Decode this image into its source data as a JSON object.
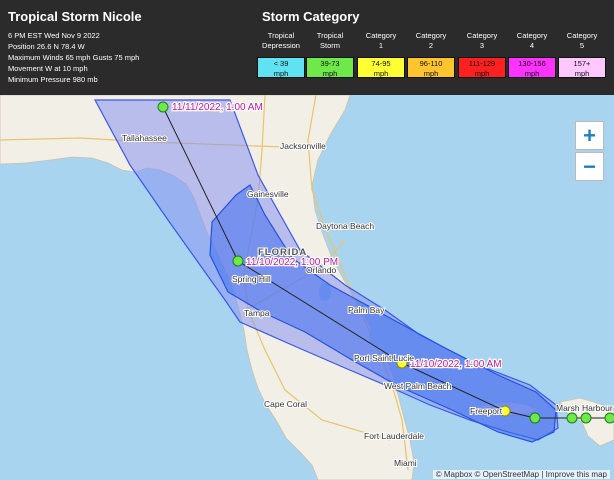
{
  "storm": {
    "name": "Tropical Storm Nicole",
    "info": [
      "6 PM EST Wed Nov 9 2022",
      "Position 26.6 N 78.4 W",
      "Maximum Winds 65 mph Gusts 75 mph",
      "Movement W at 10 mph",
      "Minimum Pressure 980 mb"
    ]
  },
  "category": {
    "title": "Storm Category",
    "items": [
      {
        "line1": "Tropical",
        "line2": "Depression",
        "range": "< 39",
        "unit": "mph",
        "color": "#5fe3f2"
      },
      {
        "line1": "Tropical",
        "line2": "Storm",
        "range": "39-73",
        "unit": "mph",
        "color": "#6fe84a"
      },
      {
        "line1": "Category",
        "line2": "1",
        "range": "74-95",
        "unit": "mph",
        "color": "#ffff33"
      },
      {
        "line1": "Category",
        "line2": "2",
        "range": "96-110",
        "unit": "mph",
        "color": "#ffc42e"
      },
      {
        "line1": "Category",
        "line2": "3",
        "range": "111-129",
        "unit": "mph",
        "color": "#ff2020"
      },
      {
        "line1": "Category",
        "line2": "4",
        "range": "130-156",
        "unit": "mph",
        "color": "#ff33ff"
      },
      {
        "line1": "Category",
        "line2": "5",
        "range": "157+",
        "unit": "mph",
        "color": "#ffc8ff"
      }
    ]
  },
  "forecast_points": [
    {
      "label": "11/11/2022, 1:00 AM"
    },
    {
      "label": "11/10/2022, 1:00 PM"
    },
    {
      "label": "11/10/2022, 1:00 AM"
    }
  ],
  "cities": {
    "tallahassee": "Tallahassee",
    "jacksonville": "Jacksonville",
    "gainesville": "Gainesville",
    "daytona": "Daytona Beach",
    "spring_hill": "Spring Hill",
    "orlando": "Orlando",
    "tampa": "Tampa",
    "palm_bay": "Palm Bay",
    "port_st_lucie": "Port Saint Lucie",
    "west_palm": "West Palm Beach",
    "freeport": "Freeport",
    "marsh_harbour": "Marsh Harbour",
    "cape_coral": "Cape Coral",
    "fort_lauderdale": "Fort Lauderdale",
    "miami": "Miami"
  },
  "state_label": "FLORIDA",
  "controls": {
    "zoom_in": "+",
    "zoom_out": "−"
  },
  "attribution": "© Mapbox © OpenStreetMap | Improve this map",
  "colors": {
    "cone_fill": "#3f6ef0",
    "cone_stroke": "#2553e0",
    "ts_point": "#6fe84a",
    "current_point": "#ffff33"
  }
}
